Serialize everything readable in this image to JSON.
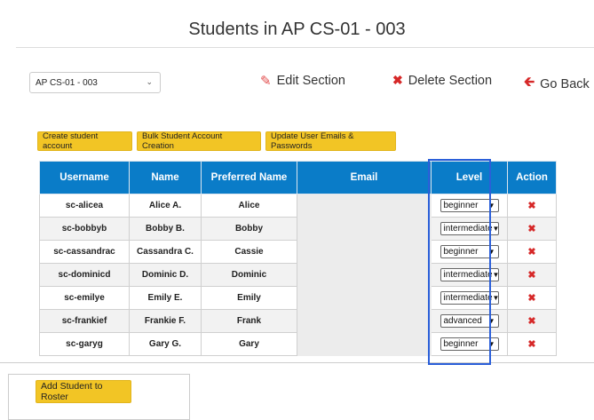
{
  "page": {
    "title": "Students in AP CS-01 - 003"
  },
  "section_select": {
    "value": "AP CS-01 - 003"
  },
  "actions": {
    "edit": "Edit Section",
    "delete": "Delete Section",
    "back": "Go Back"
  },
  "buttons": {
    "create": "Create student account",
    "bulk": "Bulk Student Account Creation",
    "update": "Update User Emails & Passwords",
    "add": "Add Student to Roster"
  },
  "table": {
    "headers": [
      "Username",
      "Name",
      "Preferred Name",
      "Email",
      "Level",
      "Action"
    ],
    "rows": [
      {
        "username": "sc-alicea",
        "name": "Alice A.",
        "preferred": "Alice",
        "email": "",
        "level": "beginner"
      },
      {
        "username": "sc-bobbyb",
        "name": "Bobby B.",
        "preferred": "Bobby",
        "email": "",
        "level": "intermediate"
      },
      {
        "username": "sc-cassandrac",
        "name": "Cassandra C.",
        "preferred": "Cassie",
        "email": "",
        "level": "beginner"
      },
      {
        "username": "sc-dominicd",
        "name": "Dominic D.",
        "preferred": "Dominic",
        "email": "",
        "level": "intermediate"
      },
      {
        "username": "sc-emilye",
        "name": "Emily E.",
        "preferred": "Emily",
        "email": "",
        "level": "intermediate"
      },
      {
        "username": "sc-frankief",
        "name": "Frankie F.",
        "preferred": "Frank",
        "email": "",
        "level": "advanced"
      },
      {
        "username": "sc-garyg",
        "name": "Gary G.",
        "preferred": "Gary",
        "email": "",
        "level": "beginner"
      }
    ]
  },
  "icons": {
    "edit": "edit-square-icon",
    "delete": "x-icon",
    "back": "arrow-left-icon",
    "row_delete": "x-icon"
  },
  "colors": {
    "accent_yellow": "#f2c525",
    "header_blue": "#0a7cc8",
    "danger_red": "#d62828",
    "focus_blue": "#2b5fd9"
  }
}
